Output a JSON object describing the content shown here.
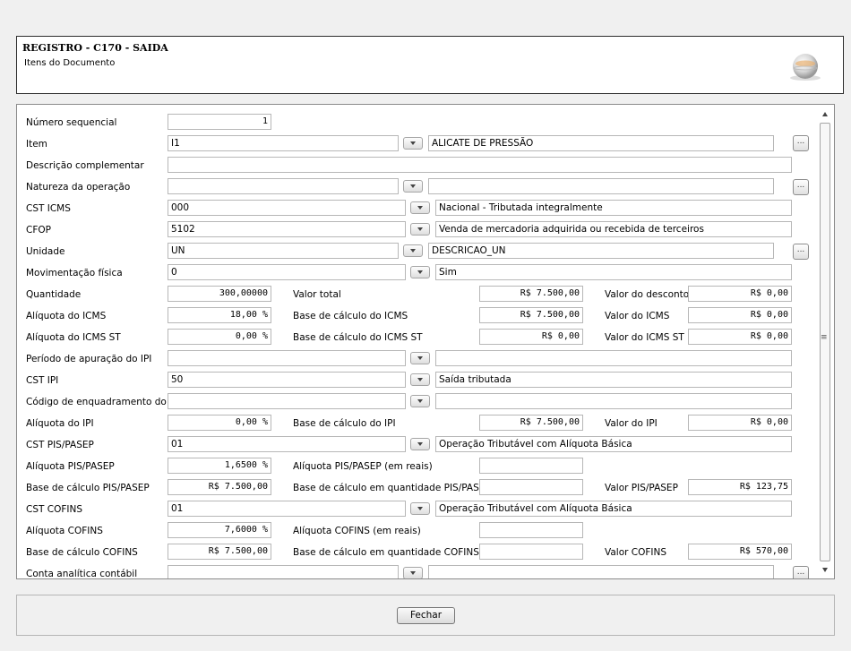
{
  "header": {
    "title": "REGISTRO - C170 - SAIDA",
    "subtitle": "Itens do Documento"
  },
  "labels": {
    "numero_seq": "Número sequencial",
    "item": "Item",
    "descr_compl": "Descrição complementar",
    "natureza": "Natureza da operação",
    "cst_icms": "CST ICMS",
    "cfop": "CFOP",
    "unidade": "Unidade",
    "mov_fisica": "Movimentação física",
    "quantidade": "Quantidade",
    "valor_total": "Valor total",
    "valor_desconto": "Valor do desconto",
    "aliq_icms": "Alíquota do ICMS",
    "base_icms": "Base de cálculo do ICMS",
    "valor_icms": "Valor do ICMS",
    "aliq_icms_st": "Alíquota do ICMS ST",
    "base_icms_st": "Base de cálculo do ICMS ST",
    "valor_icms_st": "Valor do ICMS ST",
    "periodo_ipi": "Período de apuração do IPI",
    "cst_ipi": "CST IPI",
    "cod_enq_ipi": "Código de enquadramento do IPI",
    "aliq_ipi": "Alíquota do IPI",
    "base_ipi": "Base de cálculo do IPI",
    "valor_ipi": "Valor do IPI",
    "cst_pis": "CST PIS/PASEP",
    "aliq_pis": "Alíquota PIS/PASEP",
    "aliq_pis_reais": "Alíquota PIS/PASEP (em reais)",
    "base_pis": "Base de cálculo PIS/PASEP",
    "base_qtd_pis": "Base de cálculo em quantidade PIS/PASEP",
    "valor_pis": "Valor PIS/PASEP",
    "cst_cofins": "CST COFINS",
    "aliq_cofins": "Alíquota COFINS",
    "aliq_cofins_reais": "Alíquota COFINS (em reais)",
    "base_cofins": "Base de cálculo COFINS",
    "base_qtd_cofins": "Base de cálculo em quantidade COFINS",
    "valor_cofins": "Valor COFINS",
    "conta_analitica": "Conta analítica contábil"
  },
  "values": {
    "numero_seq": "1",
    "item_code": "I1",
    "item_desc": "ALICATE DE PRESSÃO",
    "descr_compl": "",
    "natureza_code": "",
    "natureza_desc": "",
    "cst_icms_code": "000",
    "cst_icms_desc": "Nacional - Tributada integralmente",
    "cfop_code": "5102",
    "cfop_desc": "Venda de mercadoria adquirida ou recebida de terceiros",
    "unidade_code": "UN",
    "unidade_desc": "DESCRICAO_UN",
    "mov_code": "0",
    "mov_desc": "Sim",
    "quantidade": "300,00000",
    "valor_total": "R$ 7.500,00",
    "valor_desconto": "R$ 0,00",
    "aliq_icms": "18,00 %",
    "base_icms": "R$ 7.500,00",
    "valor_icms": "R$ 0,00",
    "aliq_icms_st": "0,00 %",
    "base_icms_st": "R$ 0,00",
    "valor_icms_st": "R$ 0,00",
    "periodo_ipi_code": "",
    "periodo_ipi_desc": "",
    "cst_ipi_code": "50",
    "cst_ipi_desc": "Saída tributada",
    "cod_enq_code": "",
    "cod_enq_desc": "",
    "aliq_ipi": "0,00 %",
    "base_ipi": "R$ 7.500,00",
    "valor_ipi": "R$ 0,00",
    "cst_pis_code": "01",
    "cst_pis_desc": "Operação Tributável com Alíquota Básica",
    "aliq_pis": "1,6500 %",
    "aliq_pis_reais": "",
    "base_pis": "R$ 7.500,00",
    "base_qtd_pis": "",
    "valor_pis": "R$ 123,75",
    "cst_cofins_code": "01",
    "cst_cofins_desc": "Operação Tributável com Alíquota Básica",
    "aliq_cofins": "7,6000 %",
    "aliq_cofins_reais": "",
    "base_cofins": "R$ 7.500,00",
    "base_qtd_cofins": "",
    "valor_cofins": "R$ 570,00",
    "conta_code": "",
    "conta_desc": ""
  },
  "buttons": {
    "ellipsis": "...",
    "fechar": "Fechar"
  },
  "icons": {
    "dropdown": "chevron-down-icon",
    "scroll_grip": "≡"
  }
}
